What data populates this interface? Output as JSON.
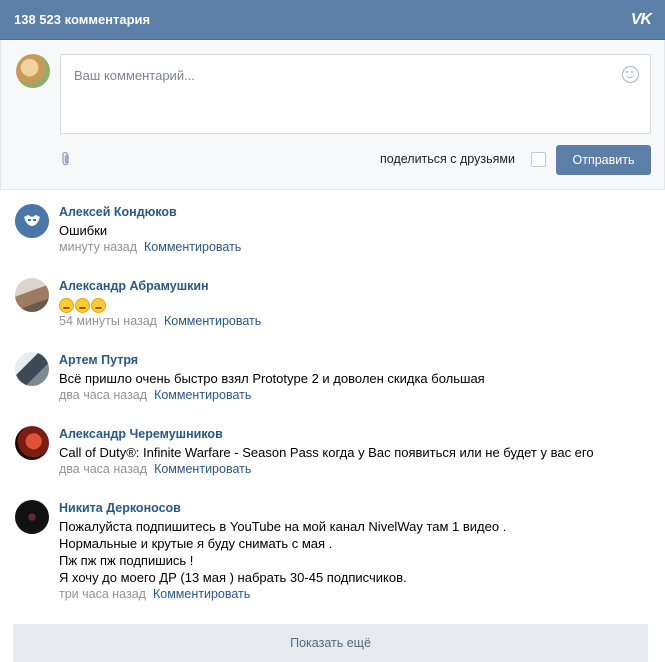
{
  "header": {
    "title": "138 523 комментария",
    "logo": "vk-logo"
  },
  "composer": {
    "placeholder": "Ваш комментарий...",
    "share_label": "поделиться с друзьями",
    "send_label": "Отправить"
  },
  "comments": [
    {
      "author": "Алексей Кондюков",
      "text": [
        "Ошибки"
      ],
      "time": "минуту назад",
      "reply": "Комментировать"
    },
    {
      "author": "Александр Абрамушкин",
      "text": [],
      "emoji_count": 3,
      "time": "54 минуты назад",
      "reply": "Комментировать"
    },
    {
      "author": "Артем Путря",
      "text": [
        "Всё пришло очень быстро взял Prototype 2 и доволен скидка большая"
      ],
      "time": "два часа назад",
      "reply": "Комментировать"
    },
    {
      "author": "Александр Черемушников",
      "text": [
        "Call of Duty®: Infinite Warfare - Season Pass когда у Вас появиться или не будет у вас его"
      ],
      "time": "два часа назад",
      "reply": "Комментировать"
    },
    {
      "author": "Никита Дерконосов",
      "text": [
        "Пожалуйста подпишитесь в YouTube на мой канал NivelWay там 1 видео .",
        "Нормальные и крутые я буду снимать с мая .",
        "Пж пж пж подпишись !",
        "Я хочу до моего ДР (13 мая ) набрать 30-45 подписчиков."
      ],
      "time": "три часа назад",
      "reply": "Комментировать"
    }
  ],
  "more_label": "Показать ещё",
  "colors": {
    "header_bg": "#5b7fa6",
    "link": "#2a5885",
    "meta": "#939393"
  }
}
